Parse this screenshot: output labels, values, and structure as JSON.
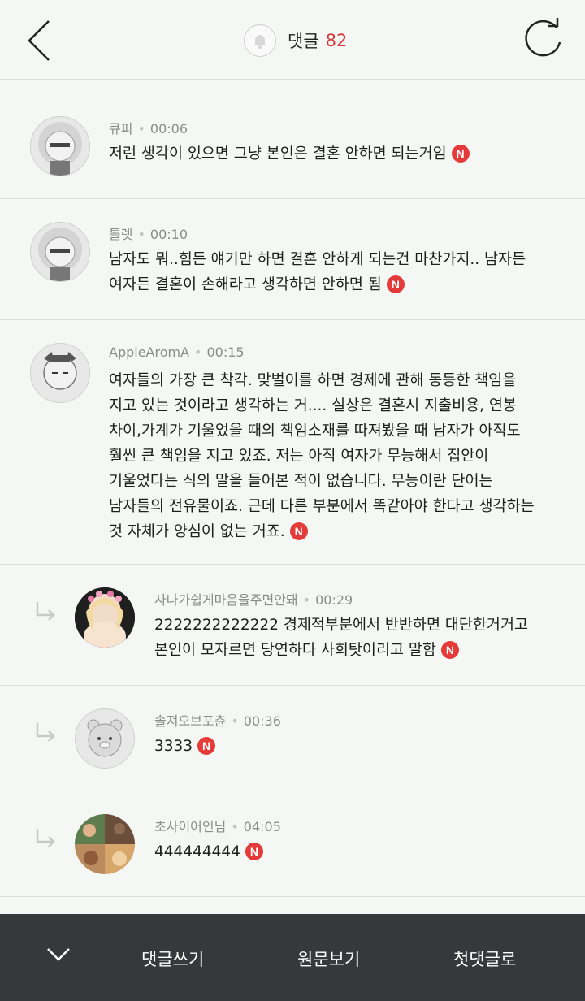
{
  "header": {
    "title": "댓글",
    "count": "82",
    "back_icon": "chevron-left-icon",
    "refresh_icon": "refresh-icon",
    "bell_icon": "bell-icon"
  },
  "comments": [
    {
      "author": "큐피",
      "time": "00:06",
      "text": "저런 생각이 있으면 그냥 본인은 결혼 안하면 되는거임",
      "badge": "N",
      "reply": false,
      "avatar": "ryan-afro-avatar"
    },
    {
      "author": "톨렛",
      "time": "00:10",
      "text": "남자도 뭐..힘든 얘기만 하면 결혼 안하게 되는건 마찬가지.. 남자든\n여자든 결혼이 손해라고 생각하면 안하면 됨",
      "badge": "N",
      "reply": false,
      "avatar": "ryan-afro-avatar"
    },
    {
      "author": "AppleAromA",
      "time": "00:15",
      "text": "여자들의 가장 큰 착각. 맞벌이를 하면 경제에 관해 동등한 책임을\n지고 있는 것이라고 생각하는 거.... 실상은 결혼시 지출비용, 연봉\n차이,가계가 기울었을 때의 책임소재를 따져봤을 때 남자가 아직도\n훨씬 큰 책임을 지고 있죠. 저는 아직 여자가 무능해서 집안이\n기울었다는 식의 말을 들어본 적이 없습니다. 무능이란 단어는\n남자들의 전유물이죠. 근데 다른 부분에서 똑같아야 한다고 생각하는\n것 자체가 양심이 없는 거죠.",
      "badge": "N",
      "reply": false,
      "avatar": "cat-avatar"
    },
    {
      "author": "사나가쉽게마음을주면안돼",
      "time": "00:29",
      "text": "2222222222222 경제적부분에서 반반하면 대단한거거고\n본인이 모자르면 당연하다 사회탓이리고 말함",
      "badge": "N",
      "reply": true,
      "avatar": "photo-avatar-blonde"
    },
    {
      "author": "솔져오브포츈",
      "time": "00:36",
      "text": "3333",
      "badge": "N",
      "reply": true,
      "avatar": "bear-avatar"
    },
    {
      "author": "초사이어인님",
      "time": "04:05",
      "text": "444444444",
      "badge": "N",
      "reply": true,
      "avatar": "photo-avatar-collage"
    }
  ],
  "bottom_bar": {
    "collapse_icon": "chevron-down-icon",
    "write_label": "댓글쓰기",
    "original_label": "원문보기",
    "first_label": "첫댓글로"
  },
  "colors": {
    "accent": "#d23b3b",
    "badge": "#e43a3a",
    "background": "#f5f7f4",
    "bottom_bar": "#35393b"
  }
}
